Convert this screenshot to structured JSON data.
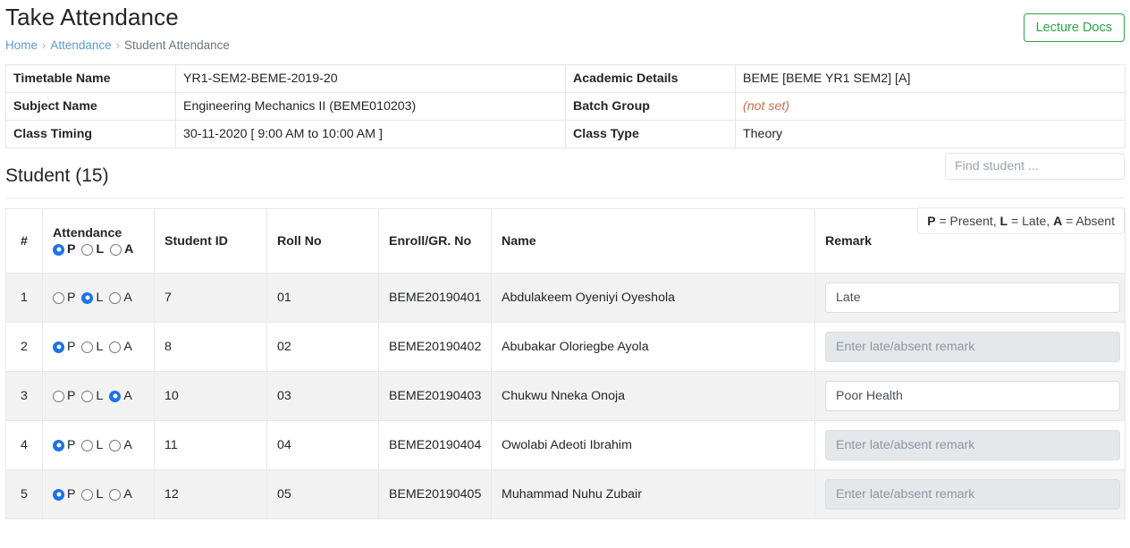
{
  "header": {
    "title": "Take Attendance",
    "breadcrumb": [
      {
        "label": "Home",
        "type": "link"
      },
      {
        "label": "Attendance",
        "type": "link"
      },
      {
        "label": "Student Attendance",
        "type": "current"
      }
    ],
    "separator": "›",
    "lecture_docs_button": "Lecture Docs",
    "accent_green": "#28a745",
    "link_blue": "#5b9bd5"
  },
  "info": {
    "timetable_name_label": "Timetable Name",
    "timetable_name_value": "YR1-SEM2-BEME-2019-20",
    "academic_details_label": "Academic Details",
    "academic_details_value": "BEME [BEME YR1 SEM2] [A]",
    "subject_name_label": "Subject Name",
    "subject_name_value": "Engineering Mechanics II (BEME010203)",
    "batch_group_label": "Batch Group",
    "batch_group_value": "(not set)",
    "batch_group_color": "#c0714d",
    "class_timing_label": "Class Timing",
    "class_timing_value": "30-11-2020 [ 9:00 AM to 10:00 AM ]",
    "class_type_label": "Class Type",
    "class_type_value": "Theory"
  },
  "student_section": {
    "heading": "Student (15)",
    "count": 15,
    "search_placeholder": "Find student ...",
    "search_value": "",
    "legend": {
      "p_key": "P",
      "p_text": " = Present, ",
      "l_key": "L",
      "l_text": " = Late, ",
      "a_key": "A",
      "a_text": " = Absent"
    }
  },
  "table": {
    "columns": {
      "num": "#",
      "attendance": "Attendance",
      "student_id": "Student ID",
      "roll_no": "Roll No",
      "enroll_no": "Enroll/GR. No",
      "name": "Name",
      "remark": "Remark"
    },
    "radio_options": {
      "p": "P",
      "l": "L",
      "a": "A"
    },
    "header_selection": "P",
    "remark_placeholder": "Enter late/absent remark",
    "rows": [
      {
        "num": "1",
        "selection": "L",
        "student_id": "7",
        "roll_no": "01",
        "enroll_no": "BEME20190401",
        "name": "Abdulakeem Oyeniyi Oyeshola",
        "remark_value": "Late",
        "remark_enabled": true
      },
      {
        "num": "2",
        "selection": "P",
        "student_id": "8",
        "roll_no": "02",
        "enroll_no": "BEME20190402",
        "name": "Abubakar Oloriegbe Ayola",
        "remark_value": "",
        "remark_enabled": false
      },
      {
        "num": "3",
        "selection": "A",
        "student_id": "10",
        "roll_no": "03",
        "enroll_no": "BEME20190403",
        "name": "Chukwu Nneka Onoja",
        "remark_value": "Poor Health",
        "remark_enabled": true
      },
      {
        "num": "4",
        "selection": "P",
        "student_id": "11",
        "roll_no": "04",
        "enroll_no": "BEME20190404",
        "name": "Owolabi Adeoti Ibrahim",
        "remark_value": "",
        "remark_enabled": false
      },
      {
        "num": "5",
        "selection": "P",
        "student_id": "12",
        "roll_no": "05",
        "enroll_no": "BEME20190405",
        "name": "Muhammad Nuhu Zubair",
        "remark_value": "",
        "remark_enabled": false
      }
    ]
  }
}
